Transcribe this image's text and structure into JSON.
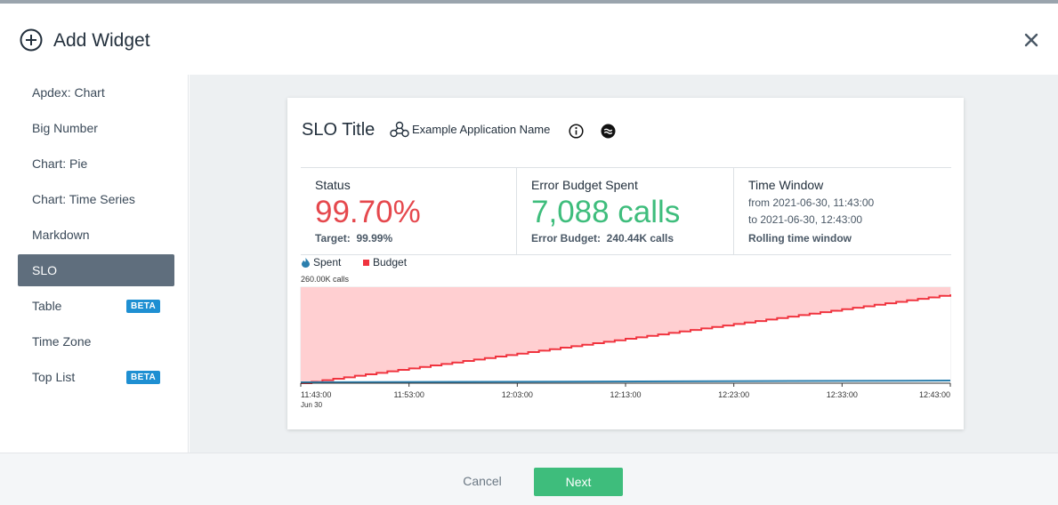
{
  "header": {
    "title": "Add Widget",
    "add_icon": "plus-circle-icon",
    "close_icon": "close-icon"
  },
  "sidebar": {
    "items": [
      {
        "label": "Apdex: Chart"
      },
      {
        "label": "Big Number"
      },
      {
        "label": "Chart: Pie"
      },
      {
        "label": "Chart: Time Series"
      },
      {
        "label": "Markdown"
      },
      {
        "label": "SLO",
        "active": true
      },
      {
        "label": "Table",
        "badge": "BETA"
      },
      {
        "label": "Time Zone"
      },
      {
        "label": "Top List",
        "badge": "BETA"
      }
    ]
  },
  "card": {
    "title": "SLO Title",
    "app_icon": "application-nodes-icon",
    "app_name": "Example Application Name",
    "info_icon": "info-icon",
    "approx_icon": "approximate-icon",
    "status": {
      "label": "Status",
      "value": "99.70%",
      "target_label": "Target:",
      "target_value": "99.99%"
    },
    "error_budget_spent": {
      "label": "Error Budget Spent",
      "value": "7,088 calls",
      "budget_label": "Error Budget:",
      "budget_value": "240.44K calls"
    },
    "time_window": {
      "label": "Time Window",
      "from": "from 2021-06-30, 11:43:00",
      "to": "to 2021-06-30, 12:43:00",
      "mode": "Rolling time window"
    },
    "legend": {
      "spent": "Spent",
      "budget": "Budget"
    }
  },
  "colors": {
    "red": "#e5484d",
    "green": "#3ebd7c",
    "budget": "#f0333e",
    "budget_fill": "#ffcfd1",
    "spent": "#2b7fae",
    "active_nav": "#5f6e7d",
    "beta": "#1e8fd2"
  },
  "chart_data": {
    "type": "area",
    "ylabel_top": "260.00K calls",
    "ylim": [
      0,
      260000
    ],
    "x_ticks": [
      "11:43:00",
      "11:53:00",
      "12:03:00",
      "12:13:00",
      "12:23:00",
      "12:33:00",
      "12:43:00"
    ],
    "x_date_label": "Jun 30",
    "grid": true,
    "series": [
      {
        "name": "Budget",
        "x": [
          "11:43:00",
          "12:43:00"
        ],
        "values": [
          0,
          240440
        ]
      },
      {
        "name": "Spent",
        "x": [
          "11:43:00",
          "12:43:00"
        ],
        "values": [
          0,
          7088
        ]
      }
    ]
  },
  "footer": {
    "cancel": "Cancel",
    "next": "Next"
  }
}
